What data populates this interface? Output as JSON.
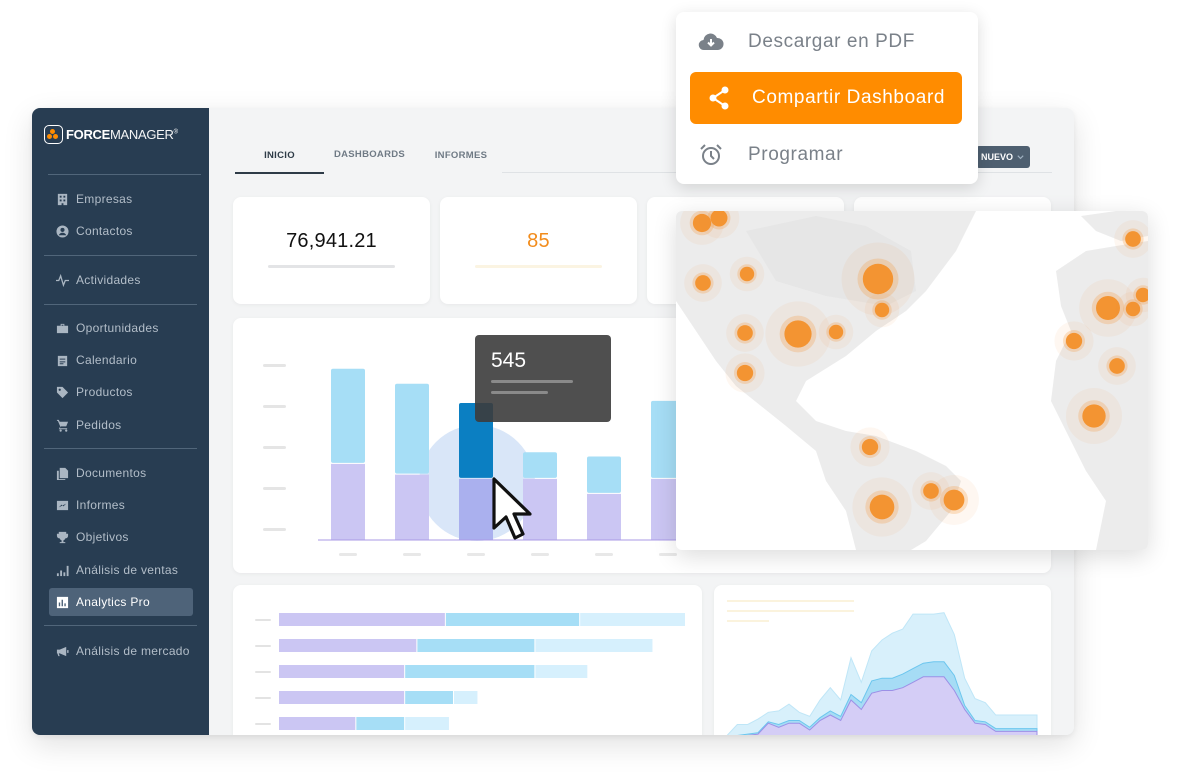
{
  "app": {
    "logo": {
      "bold": "FORCE",
      "light": "MANAGER",
      "mark": "®"
    },
    "sidebar": {
      "items": [
        {
          "label": "Empresas",
          "icon": "building-icon"
        },
        {
          "label": "Contactos",
          "icon": "contact-icon"
        },
        {
          "label": "Actividades",
          "icon": "activity-icon"
        },
        {
          "label": "Oportunidades",
          "icon": "briefcase-icon"
        },
        {
          "label": "Calendario",
          "icon": "calendar-icon"
        },
        {
          "label": "Productos",
          "icon": "tag-icon"
        },
        {
          "label": "Pedidos",
          "icon": "cart-icon"
        },
        {
          "label": "Documentos",
          "icon": "documents-icon"
        },
        {
          "label": "Informes",
          "icon": "reports-icon"
        },
        {
          "label": "Objetivos",
          "icon": "trophy-icon"
        },
        {
          "label": "Análisis de ventas",
          "icon": "bar-chart-icon"
        },
        {
          "label": "Analytics Pro",
          "icon": "analytics-icon",
          "active": true
        },
        {
          "label": "Análisis de mercado",
          "icon": "megaphone-icon"
        }
      ]
    },
    "tabs": [
      {
        "label": "INICIO",
        "active": true
      },
      {
        "label": "DASHBOARDS"
      },
      {
        "label": "INFORMES"
      }
    ],
    "new_button": {
      "label": "NUEVO"
    },
    "kpis": [
      {
        "value": "76,941.21",
        "color": "#111111"
      },
      {
        "value": "85",
        "color": "#f28c1c"
      }
    ],
    "menu": {
      "items": [
        {
          "label": "Descargar en PDF",
          "icon": "cloud-download-icon"
        },
        {
          "label": "Compartir Dashboard",
          "icon": "share-icon",
          "active": true
        },
        {
          "label": "Programar",
          "icon": "alarm-clock-icon"
        }
      ]
    },
    "tooltip": {
      "value": "545"
    },
    "colors": {
      "accent": "#ff8c00",
      "sidebar_bg": "#283d52",
      "bar_top": "#a6def6",
      "bar_bottom": "#cbc6f3",
      "bar_highlight": "#0b7fc2",
      "map_dot": "#f39432"
    }
  },
  "chart_data": [
    {
      "type": "bar",
      "title": "",
      "stacked": true,
      "categories": [
        "",
        "",
        "",
        "",
        "",
        ""
      ],
      "series": [
        {
          "name": "bottom",
          "values": [
            36,
            31,
            29,
            29,
            22,
            29
          ]
        },
        {
          "name": "top",
          "values": [
            44,
            42,
            35,
            12,
            17,
            36
          ]
        }
      ],
      "highlighted_index": 2,
      "tooltip_value": 545,
      "ylim": [
        0,
        85
      ]
    },
    {
      "type": "bar",
      "orientation": "horizontal",
      "stacked": true,
      "categories": [
        "",
        "",
        "",
        "",
        ""
      ],
      "series": [
        {
          "name": "a",
          "values": [
            41,
            34,
            31,
            31,
            19
          ]
        },
        {
          "name": "b",
          "values": [
            33,
            29,
            32,
            12,
            12
          ]
        },
        {
          "name": "c",
          "values": [
            26,
            29,
            13,
            6,
            11
          ]
        }
      ],
      "xlim": [
        0,
        100
      ]
    },
    {
      "type": "area",
      "stacked": true,
      "x": [
        0,
        1,
        2,
        3,
        4,
        5,
        6,
        7,
        8,
        9,
        10,
        11,
        12,
        13,
        14,
        15,
        16,
        17,
        18,
        19,
        20,
        21,
        22,
        23,
        24,
        25,
        26,
        27,
        28,
        29,
        30
      ],
      "series": [
        {
          "name": "base",
          "values": [
            4,
            6,
            7,
            8,
            16,
            13,
            16,
            16,
            11,
            18,
            22,
            18,
            33,
            26,
            38,
            40,
            40,
            42,
            46,
            50,
            50,
            50,
            40,
            26,
            16,
            15,
            10,
            10,
            10,
            10,
            10
          ]
        },
        {
          "name": "mid",
          "values": [
            1,
            1,
            1,
            1,
            1,
            2,
            2,
            2,
            2,
            2,
            3,
            3,
            4,
            5,
            9,
            9,
            9,
            10,
            10,
            10,
            11,
            11,
            11,
            3,
            2,
            2,
            2,
            2,
            2,
            2,
            2
          ]
        },
        {
          "name": "top",
          "values": [
            2,
            8,
            7,
            10,
            7,
            10,
            12,
            6,
            8,
            13,
            17,
            12,
            27,
            15,
            22,
            28,
            33,
            33,
            40,
            36,
            35,
            36,
            30,
            20,
            16,
            14,
            10,
            10,
            10,
            10,
            10
          ]
        }
      ],
      "ylim": [
        0,
        110
      ]
    },
    {
      "type": "scatter",
      "title": "map",
      "points": [
        {
          "x": 26,
          "y": 12,
          "size": 1.6
        },
        {
          "x": 43,
          "y": 7,
          "size": 1.4
        },
        {
          "x": 71,
          "y": 63,
          "size": 1.0
        },
        {
          "x": 202,
          "y": 68,
          "size": 3.5
        },
        {
          "x": 206,
          "y": 99,
          "size": 1.0
        },
        {
          "x": 27,
          "y": 72,
          "size": 1.2
        },
        {
          "x": 69,
          "y": 122,
          "size": 1.2
        },
        {
          "x": 122,
          "y": 123,
          "size": 3.0
        },
        {
          "x": 160,
          "y": 121,
          "size": 1.0
        },
        {
          "x": 69,
          "y": 162,
          "size": 1.3
        },
        {
          "x": 194,
          "y": 236,
          "size": 1.3
        },
        {
          "x": 206,
          "y": 296,
          "size": 2.6
        },
        {
          "x": 255,
          "y": 280,
          "size": 1.2
        },
        {
          "x": 278,
          "y": 289,
          "size": 2.0
        },
        {
          "x": 432,
          "y": 97,
          "size": 2.5
        },
        {
          "x": 457,
          "y": 98,
          "size": 1.0
        },
        {
          "x": 467,
          "y": 84,
          "size": 1.0
        },
        {
          "x": 398,
          "y": 130,
          "size": 1.3
        },
        {
          "x": 441,
          "y": 155,
          "size": 1.2
        },
        {
          "x": 418,
          "y": 205,
          "size": 2.4
        },
        {
          "x": 457,
          "y": 28,
          "size": 1.2
        }
      ]
    }
  ]
}
